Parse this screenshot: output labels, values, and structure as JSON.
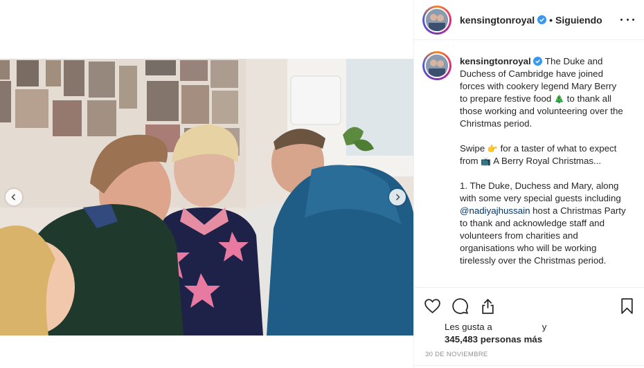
{
  "post": {
    "username": "kensingtonroyal",
    "follow_separator": "•",
    "follow_label": "Siguiendo",
    "caption_paragraphs": [
      {
        "pre": "The Duke and Duchess of Cambridge have joined forces with cookery legend Mary Berry to prepare festive food ",
        "emoji": "🎄",
        "post": " to thank all those working and volunteering over the Christmas period."
      },
      {
        "pre": "Swipe ",
        "emoji": "👉",
        "post": " for a taster of what to expect from ",
        "emoji2": "📺",
        "post2": " A Berry Royal Christmas..."
      },
      {
        "pre": "1. The Duke, Duchess and Mary, along with some very special guests including ",
        "mention": "@nadiyajhussain",
        "post": " host a Christmas Party to thank and acknowledge staff and volunteers from charities and organisations who will be working tirelessly over the Christmas period."
      }
    ],
    "likes_prefix": "Les gusta a",
    "likes_suffix": "y",
    "likes_count": "345,483 personas más",
    "timestamp": "30 DE NOVIEMBRE"
  },
  "icons": {
    "verified": "verified-badge-icon",
    "more": "more-options-icon",
    "like": "heart-icon",
    "comment": "comment-icon",
    "share": "share-icon",
    "save": "bookmark-icon",
    "prev": "chevron-left-icon",
    "next": "chevron-right-icon"
  },
  "colors": {
    "verified_blue": "#3897f0",
    "mention_blue": "#003569",
    "text": "#262626",
    "muted": "#8e8e8e"
  }
}
